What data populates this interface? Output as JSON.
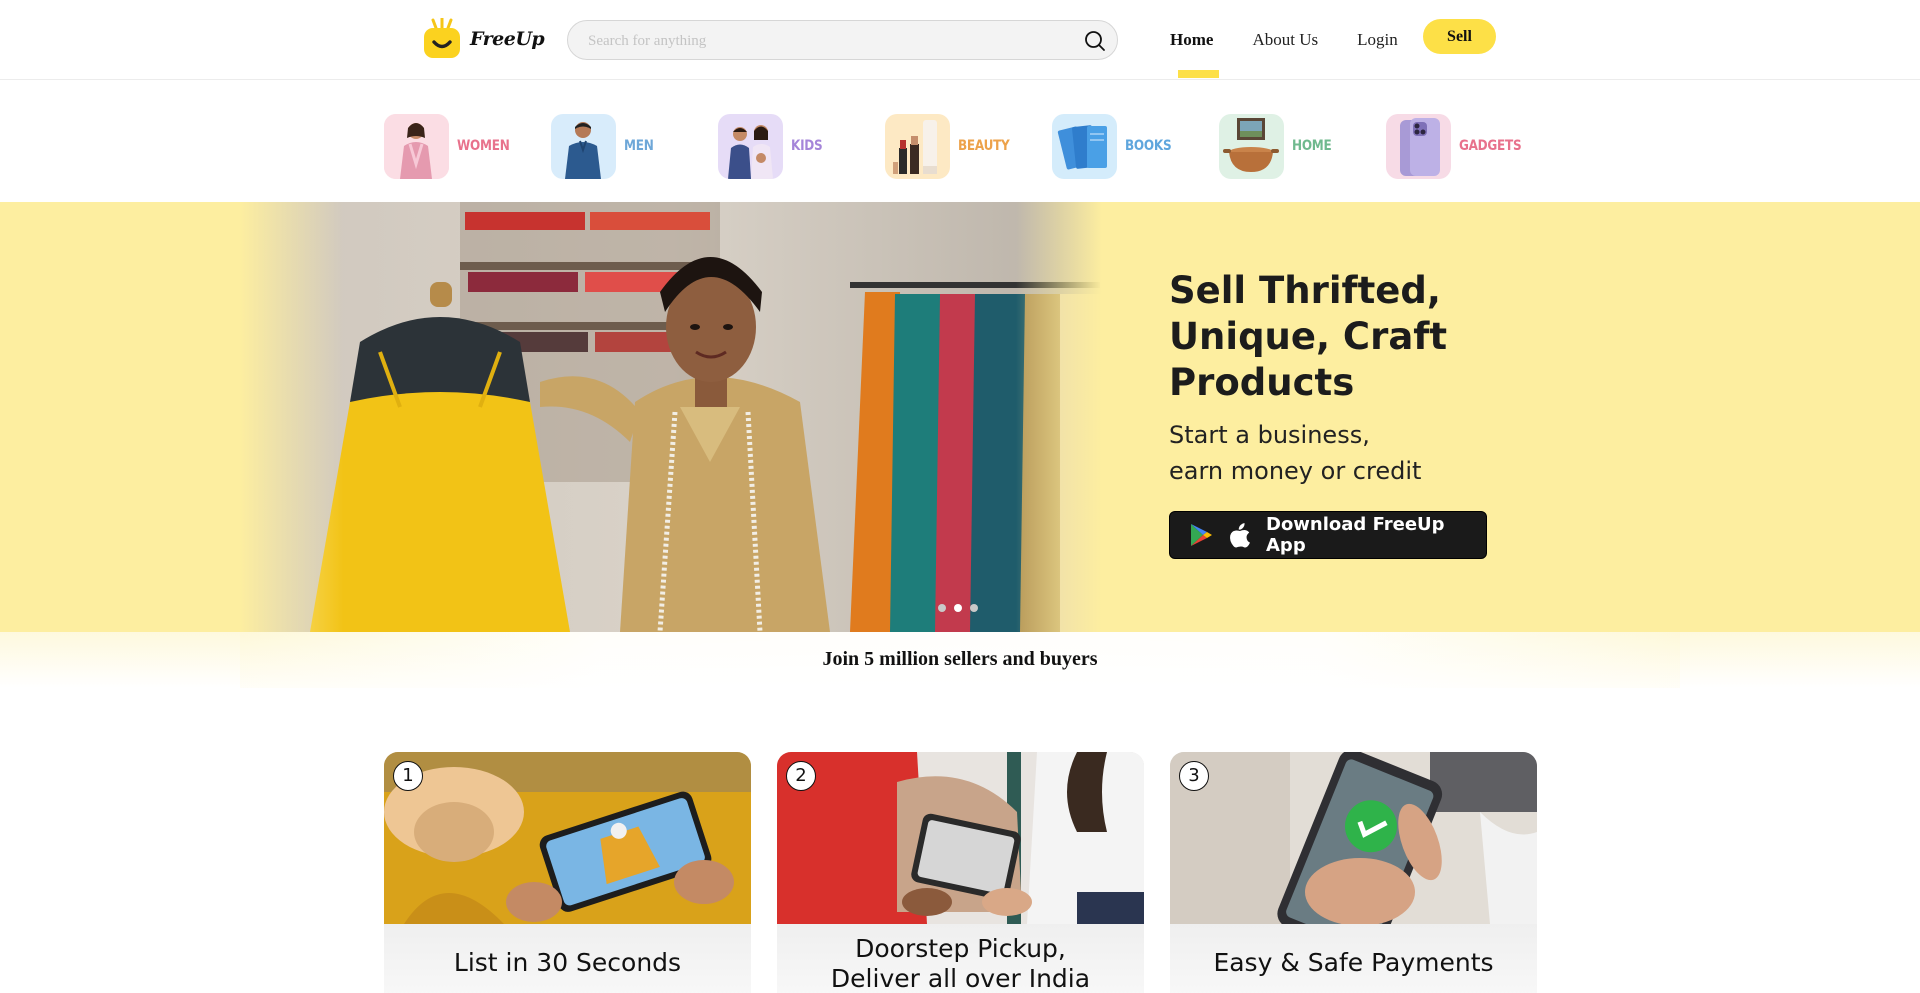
{
  "header": {
    "logo_text": "FreeUp",
    "search_placeholder": "Search for anything",
    "nav": {
      "home": "Home",
      "about": "About Us",
      "login": "Login",
      "sell": "Sell"
    }
  },
  "categories": [
    {
      "label": "WOMEN",
      "color": "#e8728c"
    },
    {
      "label": "MEN",
      "color": "#6ea7d8"
    },
    {
      "label": "KIDS",
      "color": "#a585d9"
    },
    {
      "label": "BEAUTY",
      "color": "#eda24a"
    },
    {
      "label": "BOOKS",
      "color": "#5fa6dd"
    },
    {
      "label": "HOME",
      "color": "#6fb98e"
    },
    {
      "label": "GADGETS",
      "color": "#e8728c"
    }
  ],
  "hero": {
    "title": "Sell Thrifted, Unique, Craft Products",
    "subtitle_line1": "Start a business,",
    "subtitle_line2": "earn money or credit",
    "download_label": "Download FreeUp App",
    "background": "#fdeea0",
    "active_slide": 2,
    "slides": 3
  },
  "join_text": "Join 5 million sellers and buyers",
  "steps": [
    {
      "number": "1",
      "title": "List in 30 Seconds"
    },
    {
      "number": "2",
      "title_line1": "Doorstep Pickup,",
      "title_line2": "Deliver all over India"
    },
    {
      "number": "3",
      "title": "Easy & Safe Payments"
    }
  ],
  "colors": {
    "accent": "#fde047",
    "dark_button": "#1a1a1a"
  }
}
